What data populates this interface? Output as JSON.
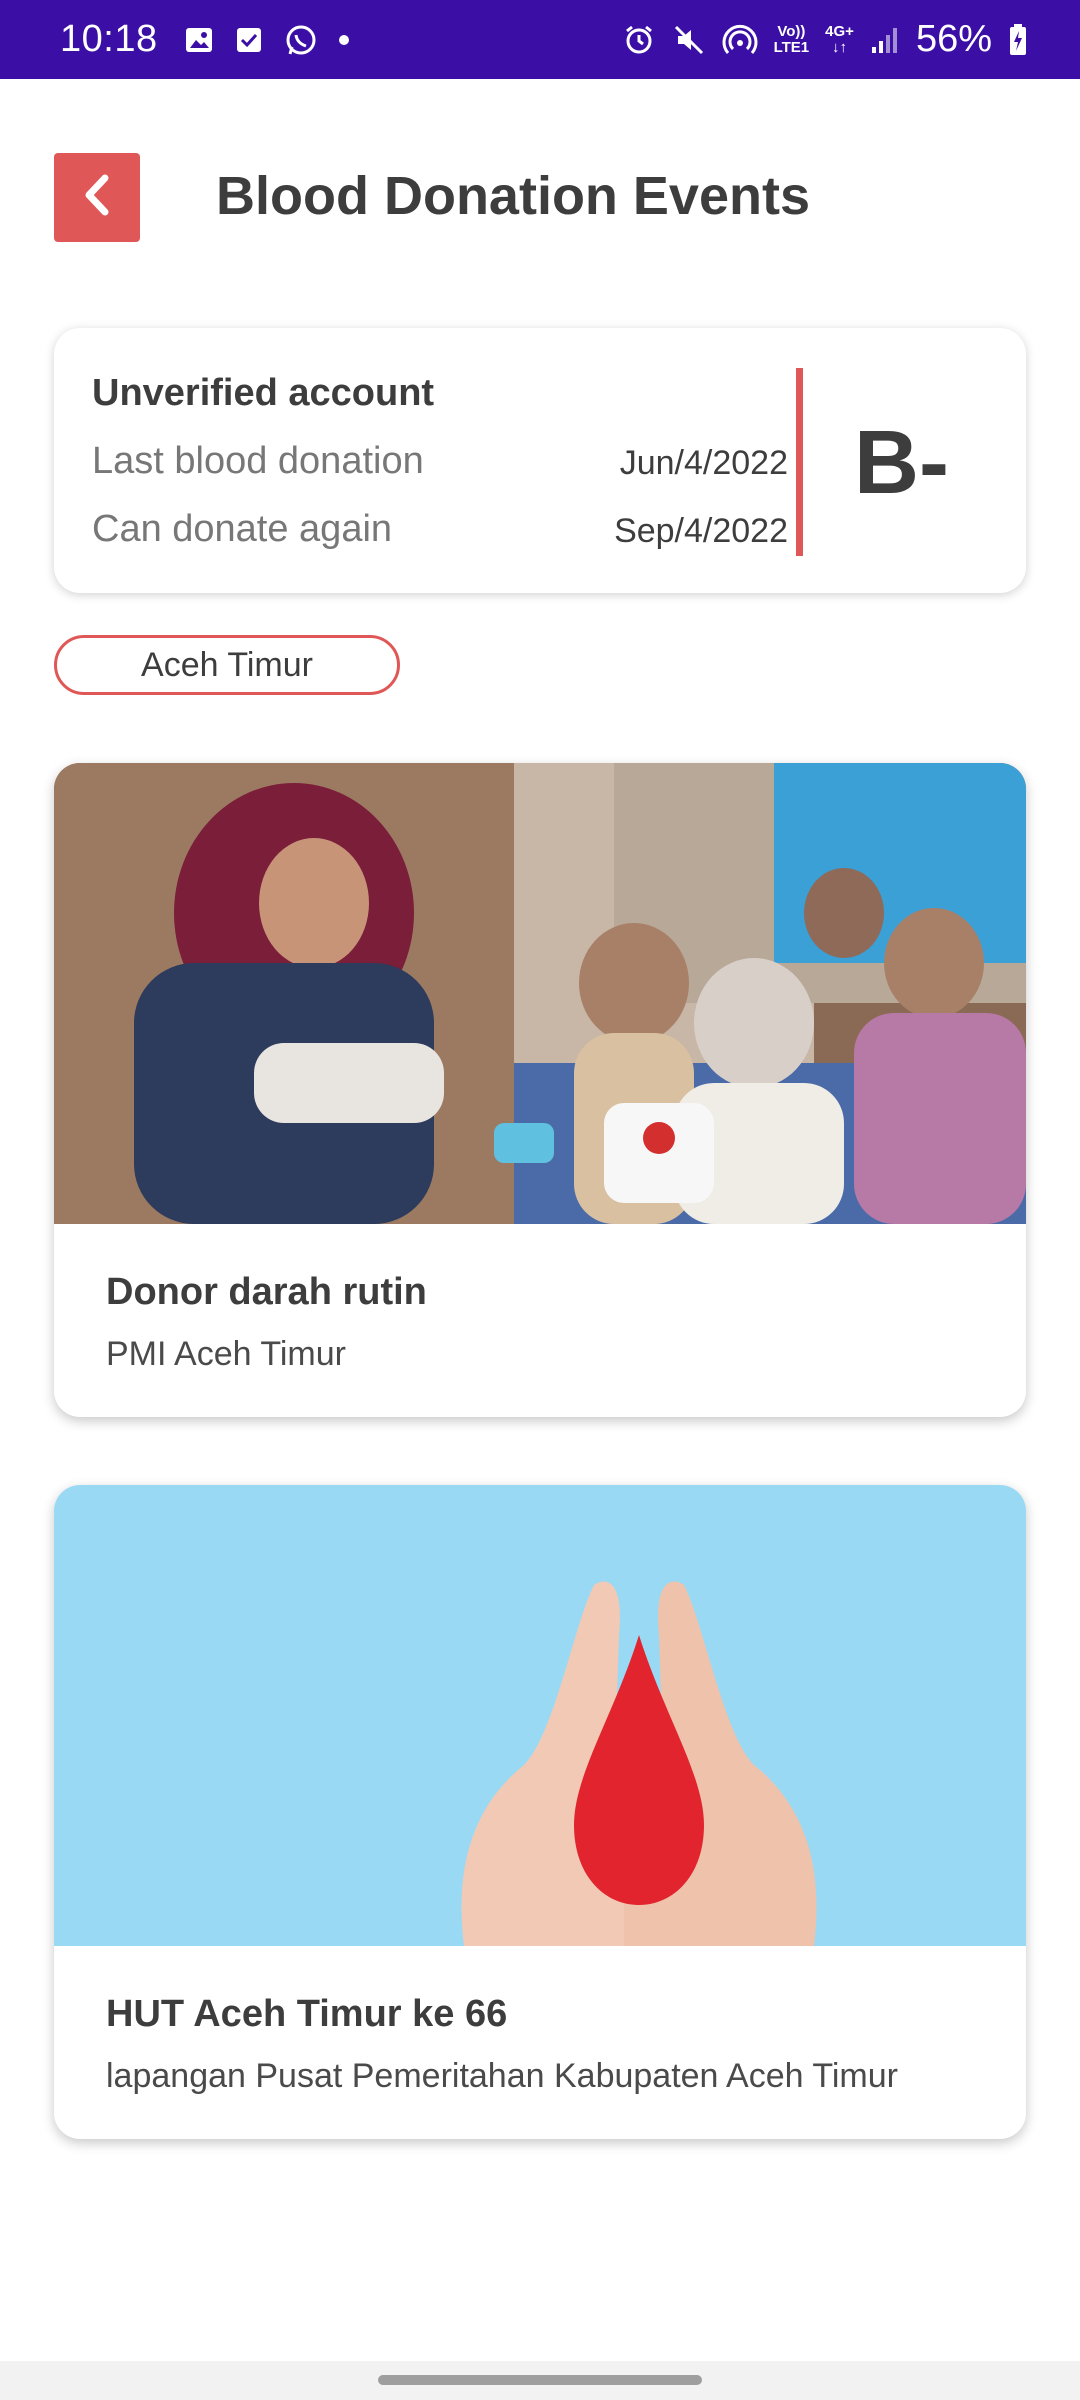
{
  "status_bar": {
    "time": "10:18",
    "notification_icons": [
      "gallery-icon",
      "checkbox-icon",
      "whatsapp-icon",
      "dot-icon"
    ],
    "system_icons": [
      "alarm-icon",
      "mute-icon",
      "hotspot-icon",
      "volte-icon",
      "4g-icon",
      "signal-icon"
    ],
    "volte_label_1": "Vo))",
    "volte_label_2": "LTE1",
    "network_label": "4G+",
    "battery_percent": "56%"
  },
  "header": {
    "title": "Blood Donation Events",
    "back_icon": "chevron-left-icon"
  },
  "donor_card": {
    "account_status": "Unverified account",
    "last_donation_label": "Last blood donation",
    "last_donation_value": "Jun/4/2022",
    "next_donation_label": "Can donate again",
    "next_donation_value": "Sep/4/2022",
    "blood_type": "B-"
  },
  "region_filter": {
    "label": "Aceh Timur"
  },
  "events": [
    {
      "title": "Donor darah rutin",
      "location": "PMI Aceh Timur",
      "image": "volunteer-distributing-aid-photo"
    },
    {
      "title": "HUT Aceh Timur ke 66",
      "location": "lapangan Pusat Pemeritahan Kabupaten Aceh Timur",
      "image": "hands-holding-blood-drop-photo"
    }
  ],
  "colors": {
    "status_bar_bg": "#3b0fa6",
    "accent_red": "#e05757",
    "text_dark": "#3d3d3d",
    "text_muted": "#777777",
    "sky_blue": "#9ad9f3"
  }
}
